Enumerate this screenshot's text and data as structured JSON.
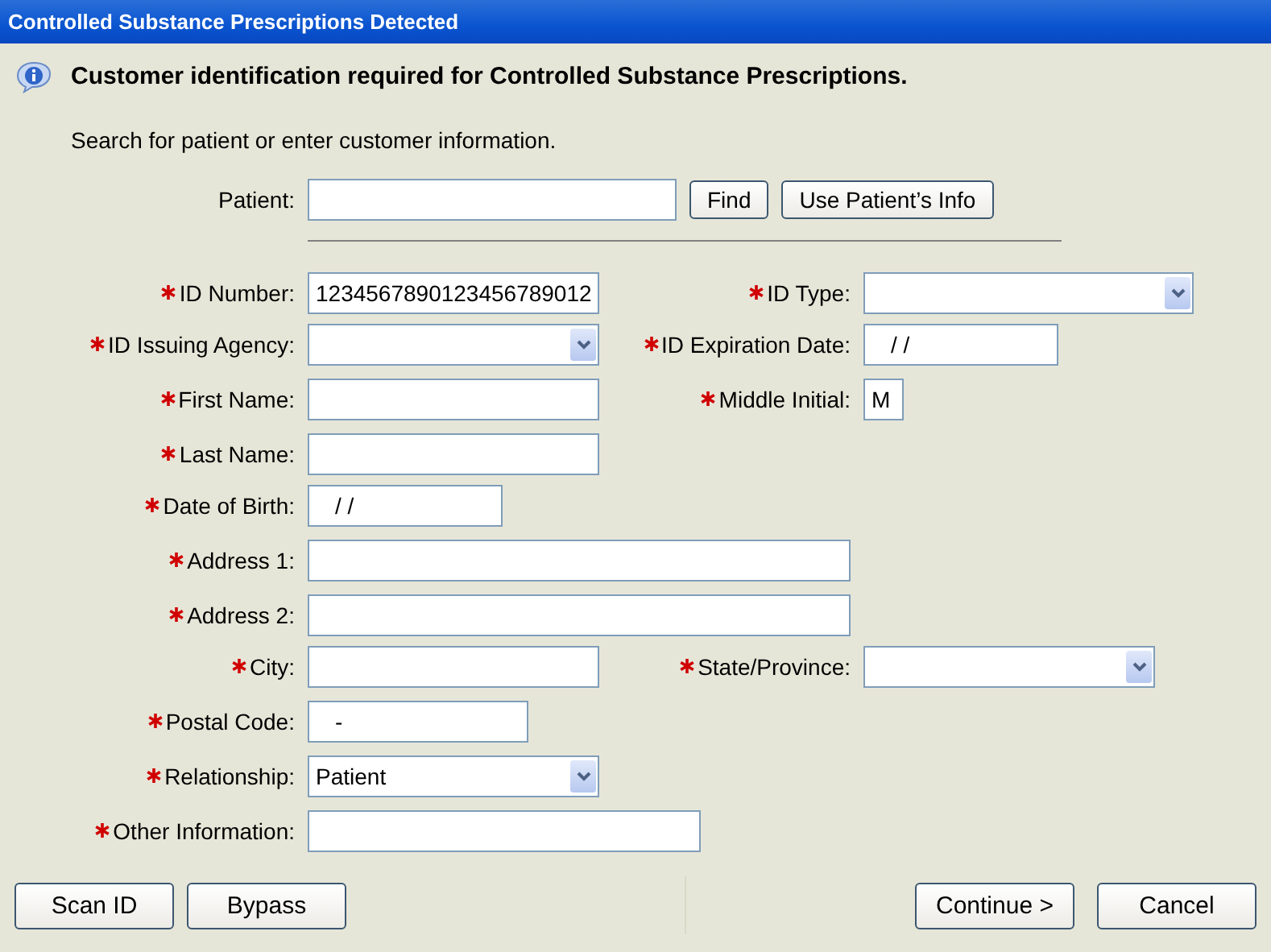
{
  "window": {
    "title": "Controlled Substance Prescriptions Detected"
  },
  "heading": "Customer identification required for Controlled Substance Prescriptions.",
  "instruction": "Search for patient or enter customer information.",
  "patient": {
    "label": "Patient:",
    "buttons": [
      "Find",
      "Use Patient’s Info"
    ]
  },
  "fields": [
    {
      "label": "ID Number:",
      "required": true,
      "kind": "text",
      "value": "1234567890123456789012"
    },
    {
      "label": "ID Type:",
      "required": true,
      "kind": "select"
    },
    {
      "label": "ID Issuing Agency:",
      "required": true,
      "kind": "select"
    },
    {
      "label": "ID Expiration Date:",
      "required": true,
      "kind": "masked",
      "value": "/ /"
    },
    {
      "label": "First Name:",
      "required": true,
      "kind": "text"
    },
    {
      "label": "Middle Initial:",
      "required": true,
      "kind": "text",
      "value": "M"
    },
    {
      "label": "Last Name:",
      "required": true,
      "kind": "text"
    },
    {
      "label": "Date of Birth:",
      "required": true,
      "kind": "masked",
      "value": "/ /"
    },
    {
      "label": "Address 1:",
      "required": true,
      "kind": "text"
    },
    {
      "label": "Address 2:",
      "required": true,
      "kind": "text"
    },
    {
      "label": "City:",
      "required": true,
      "kind": "text"
    },
    {
      "label": "State/Province:",
      "required": true,
      "kind": "select"
    },
    {
      "label": "Postal Code:",
      "required": true,
      "kind": "masked",
      "value": "-"
    },
    {
      "label": "Relationship:",
      "required": true,
      "kind": "select",
      "value": "Patient"
    },
    {
      "label": "Other Information:",
      "required": true,
      "kind": "text"
    }
  ],
  "footer": {
    "left_buttons": [
      "Scan ID",
      "Bypass"
    ],
    "right_buttons": [
      "Continue >",
      "Cancel"
    ]
  }
}
